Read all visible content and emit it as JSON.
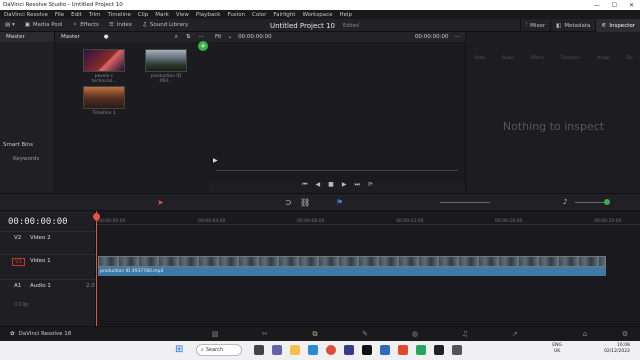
{
  "window": {
    "title": "DaVinci Resolve Studio - Untitled Project 10",
    "controls": [
      "—",
      "☐",
      "✕"
    ]
  },
  "menu": [
    "DaVinci Resolve",
    "File",
    "Edit",
    "Trim",
    "Timeline",
    "Clip",
    "Mark",
    "View",
    "Playback",
    "Fusion",
    "Color",
    "Fairlight",
    "Workspace",
    "Help"
  ],
  "toolbar": {
    "media_pool": "Media Pool",
    "effects": "Effects",
    "index": "Index",
    "sound_library": "Sound Library",
    "project_title": "Untitled Project 10",
    "edited": "Edited",
    "mixer": "Mixer",
    "metadata": "Metadata",
    "inspector": "Inspector"
  },
  "left_panel": {
    "master": "Master",
    "smart_bins": "Smart Bins",
    "keywords": "Keywords"
  },
  "media_pool": {
    "header": "Master",
    "clips": [
      {
        "name": "pexels-c technical..."
      },
      {
        "name": "production ID 493..."
      },
      {
        "name": "Timeline 1"
      }
    ]
  },
  "viewer": {
    "fit": "Fit",
    "timecode_left": "00:00:00:00",
    "timecode_right": "00:00:00:00"
  },
  "inspector": {
    "tabs": [
      "Video",
      "Audio",
      "Effects",
      "Transition",
      "Image",
      "File"
    ],
    "empty_text": "Nothing to inspect"
  },
  "timeline": {
    "timecode": "00:00:00:00",
    "ruler": [
      "00:00:00:00",
      "00:00:04:00",
      "00:00:08:00",
      "00:00:12:00",
      "00:00:16:00",
      "00:00:20:00"
    ],
    "tracks": [
      {
        "id": "V2",
        "name": "Video 2"
      },
      {
        "id": "V1",
        "name": "Video 1"
      },
      {
        "id": "A1",
        "name": "Audio 1",
        "level": "2.0"
      }
    ],
    "clip_label": "production ID 4937780.mp4",
    "a1_meta": "0 Clip"
  },
  "page_bar": {
    "app": "DaVinci Resolve 18"
  },
  "taskbar": {
    "search": "Search",
    "lang1": "ENG",
    "lang2": "UK",
    "time": "16:08",
    "date": "02/12/2022"
  }
}
